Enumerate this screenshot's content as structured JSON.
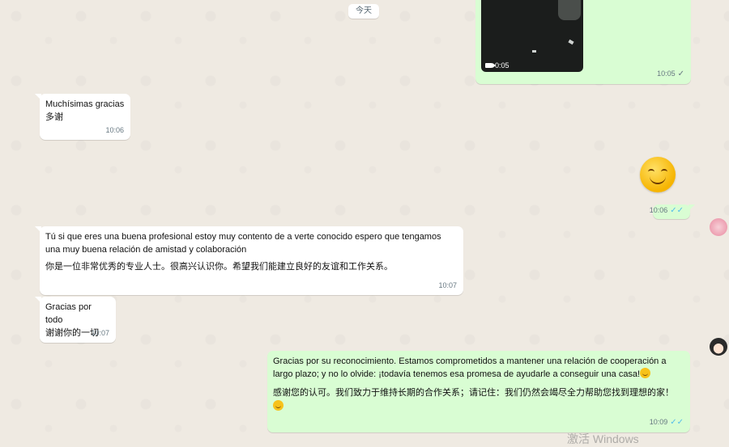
{
  "date_divider": "今天",
  "messages": [
    {
      "id": "video",
      "duration": "0:05",
      "time": "10:05"
    },
    {
      "id": "m1",
      "lines": [
        "Muchísimas gracias",
        "多谢"
      ],
      "time": "10:06"
    },
    {
      "id": "emoji",
      "time": "10:06"
    },
    {
      "id": "m2",
      "es": "Tú si que eres una buena profesional estoy muy contento de a verte conocido espero que tengamos una muy buena relación de amistad y colaboración",
      "zh": "你是一位非常优秀的专业人士。很高兴认识你。希望我们能建立良好的友谊和工作关系。",
      "time": "10:07"
    },
    {
      "id": "m3",
      "lines": [
        "Gracias por todo",
        "谢谢你的一切"
      ],
      "time": "10:07"
    },
    {
      "id": "m4",
      "es": "Gracias por su reconocimiento. Estamos comprometidos a mantener una relación de cooperación a largo plazo; y no lo olvide: ¡todavía tenemos esa promesa de ayudarle a conseguir una casa!",
      "zh": "感谢您的认可。我们致力于维持长期的合作关系；请记住：我们仍然会竭尽全力帮助您找到理想的家！",
      "time": "10:09"
    }
  ],
  "watermark": "激活 Windows",
  "colors": {
    "outgoing": "#d9fdd3",
    "incoming": "#ffffff",
    "read_tick": "#53bdeb",
    "sent_tick": "#667781"
  }
}
